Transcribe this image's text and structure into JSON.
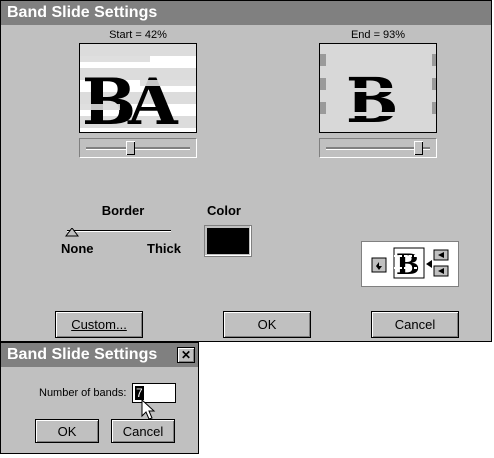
{
  "main_dialog": {
    "title": "Band Slide Settings",
    "start_label": "Start = 42%",
    "start_value": 0.42,
    "end_label": "End = 93%",
    "end_value": 0.93,
    "border_label": "Border",
    "border_min": "None",
    "border_max": "Thick",
    "color_label": "Color",
    "swatch_color": "#000000",
    "buttons": {
      "custom": "Custom...",
      "ok": "OK",
      "cancel": "Cancel"
    }
  },
  "sub_dialog": {
    "title": "Band Slide Settings",
    "close_icon": "close-icon",
    "field_label": "Number of bands:",
    "field_value": "7",
    "buttons": {
      "ok": "OK",
      "cancel": "Cancel"
    }
  }
}
